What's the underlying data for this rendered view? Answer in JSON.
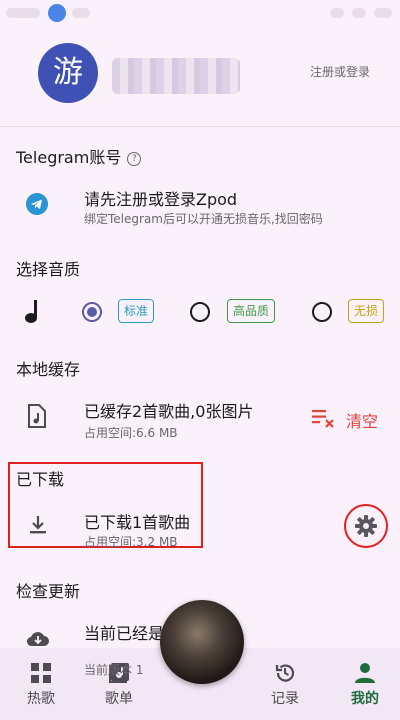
{
  "status_bar": {},
  "header": {
    "avatar_text": "游",
    "login_link": "注册或登录"
  },
  "telegram": {
    "title": "Telegram账号",
    "info_icon": "?",
    "prompt": "请先注册或登录Zpod",
    "desc": "绑定Telegram后可以开通无损音乐,找回密码",
    "icon": "telegram-icon"
  },
  "quality": {
    "title": "选择音质",
    "options": [
      {
        "label": "标准",
        "selected": true,
        "color": "#2a9bbf"
      },
      {
        "label": "高品质",
        "selected": false,
        "color": "#3f9b46"
      },
      {
        "label": "无损",
        "selected": false,
        "color": "#c9a213"
      }
    ]
  },
  "cache": {
    "title": "本地缓存",
    "summary": "已缓存2首歌曲,0张图片",
    "space": "占用空间:6.6 MB",
    "clear_label": "清空"
  },
  "downloaded": {
    "title": "已下载",
    "summary": "已下载1首歌曲",
    "space": "占用空间:3.2 MB"
  },
  "update": {
    "title": "检查更新",
    "status": "当前已经是最",
    "version_partial": "当前版本 1"
  },
  "nav": [
    {
      "label": "热歌",
      "icon": "grid-icon",
      "active": false
    },
    {
      "label": "歌单",
      "icon": "playlist-icon",
      "active": false
    },
    {
      "label": "记录",
      "icon": "history-icon",
      "active": false
    },
    {
      "label": "我的",
      "icon": "person-icon",
      "active": true
    }
  ],
  "colors": {
    "background": "#fbf1fb",
    "accent": "#5c5ba8",
    "danger": "#e0443c",
    "active_nav": "#1f6b3a"
  }
}
